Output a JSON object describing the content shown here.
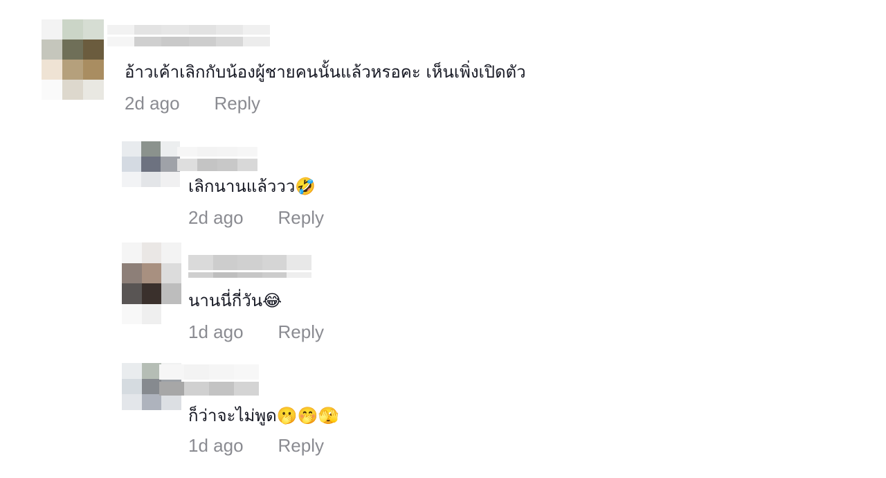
{
  "comments": [
    {
      "text": "อ้าวเค้าเลิกกับน้องผู้ชายคนนั้นแล้วหรอคะ เห็นเพิ่งเปิดตัว",
      "time": "2d ago",
      "reply_label": "Reply"
    },
    {
      "text": "เลิกนานแล้ววว🤣",
      "time": "2d ago",
      "reply_label": "Reply"
    },
    {
      "text": "นานนี่กี่วัน😂",
      "time": "1d ago",
      "reply_label": "Reply"
    },
    {
      "text": "ก็ว่าจะไม่พูด🫢🤭🫣",
      "time": "1d ago",
      "reply_label": "Reply"
    }
  ]
}
